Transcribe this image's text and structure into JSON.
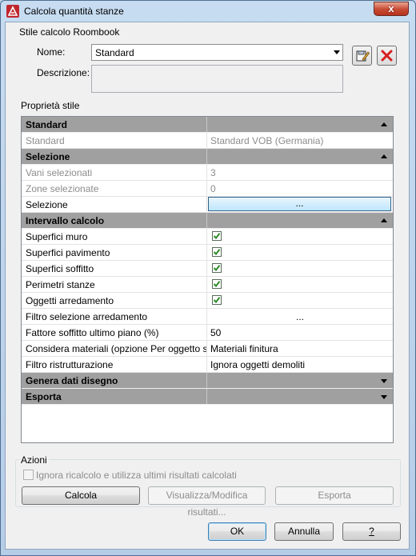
{
  "window": {
    "title": "Calcola quantità stanze",
    "close_glyph": "x"
  },
  "style_group": {
    "label": "Stile calcolo Roombook",
    "name_label": "Nome:",
    "name_value": "Standard",
    "description_label": "Descrizione:",
    "description_value": ""
  },
  "props_group": {
    "label": "Proprietà stile"
  },
  "grid": {
    "standard": {
      "header": "Standard",
      "row_label": "Standard",
      "row_value": "Standard VOB (Germania)"
    },
    "selezione": {
      "header": "Selezione",
      "vani_label": "Vani selezionati",
      "vani_value": "3",
      "zone_label": "Zone selezionate",
      "zone_value": "0",
      "sel_label": "Selezione",
      "sel_button": "..."
    },
    "intervallo": {
      "header": "Intervallo calcolo",
      "rows": [
        {
          "label": "Superfici muro",
          "checked": true
        },
        {
          "label": "Superfici pavimento",
          "checked": true
        },
        {
          "label": "Superfici soffitto",
          "checked": true
        },
        {
          "label": "Perimetri stanze",
          "checked": true
        },
        {
          "label": "Oggetti arredamento",
          "checked": true
        }
      ],
      "filtro_label": "Filtro selezione arredamento",
      "filtro_value": "...",
      "fattore_label": "Fattore soffitto ultimo piano (%)",
      "fattore_value": "50",
      "materiali_label": "Considera materiali (opzione Per oggetto s",
      "materiali_value": "Materiali finitura",
      "ristrutturazione_label": "Filtro ristrutturazione",
      "ristrutturazione_value": "Ignora oggetti demoliti"
    },
    "genera": {
      "header": "Genera dati disegno"
    },
    "esporta": {
      "header": "Esporta"
    }
  },
  "actions_group": {
    "label": "Azioni",
    "ignore_checkbox_label": "Ignora ricalcolo e utilizza ultimi risultati calcolati",
    "ignore_checked": false,
    "calcola": "Calcola",
    "visualizza": "Visualizza/Modifica risultati...",
    "esporta": "Esporta"
  },
  "footer": {
    "ok": "OK",
    "annulla": "Annulla",
    "help": "?"
  },
  "colors": {
    "category_row": "#a0a0a0",
    "accent": "#3c7fb1",
    "check": "#2d8a2d"
  }
}
